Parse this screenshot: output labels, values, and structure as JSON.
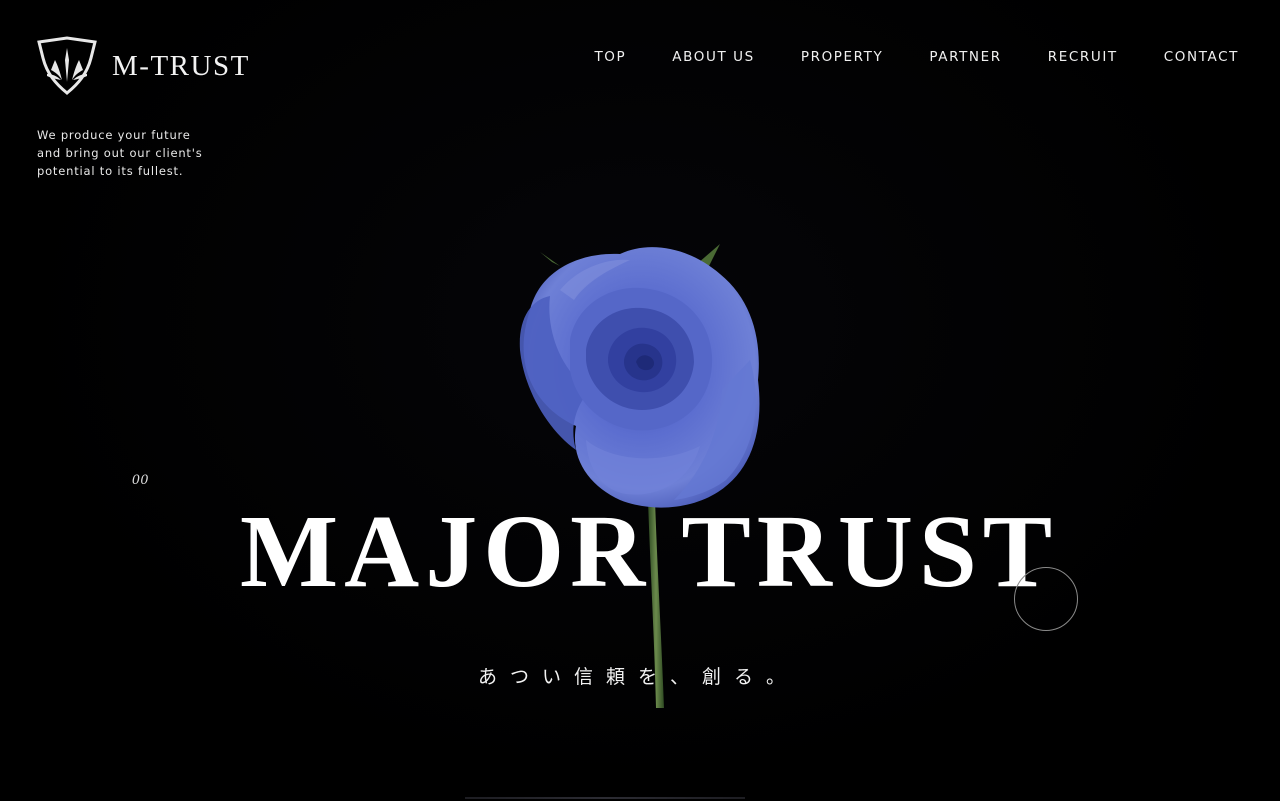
{
  "header": {
    "logo_text": "M-TRUST",
    "nav": [
      "TOP",
      "ABOUT US",
      "PROPERTY",
      "PARTNER",
      "RECRUIT",
      "CONTACT"
    ]
  },
  "tagline": {
    "lines": [
      "We produce your future",
      "and bring out our client's",
      "potential to its fullest."
    ]
  },
  "hero": {
    "index": "00",
    "title": "MAJOR TRUST",
    "subtitle": "あつい信頼を、創る。"
  },
  "colors": {
    "background": "#000000",
    "rose": "#5a6dcc",
    "stem": "#4d6b3c",
    "text": "#ffffff"
  }
}
